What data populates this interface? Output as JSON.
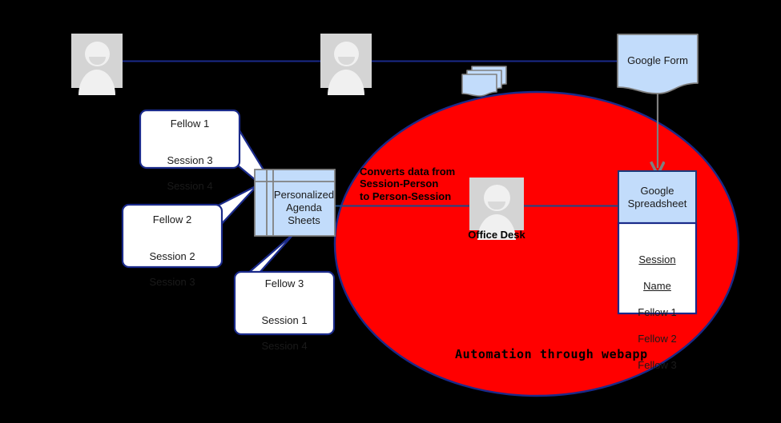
{
  "diagram": {
    "title": "Automation through webapp",
    "colors": {
      "background": "#000000",
      "process_fill": "#ff0000",
      "process_stroke": "#1a2a8a",
      "node_fill": "#c2dcfb",
      "node_stroke": "#1b3a7a",
      "callout_fill": "#ffffff",
      "callout_stroke": "#1a2a8a",
      "connector": "#1a2a8a",
      "arrow_gray": "#7f7f7f",
      "avatar_bg": "#d4d4d4"
    }
  },
  "people": [
    {
      "name": "person-1"
    },
    {
      "name": "person-2"
    }
  ],
  "nodes": {
    "google_form": {
      "label": "Google Form"
    },
    "agenda_sheets": {
      "label": "Personalized\nAgenda\nSheets"
    },
    "google_spreadsheet": {
      "label": "Google\nSpreadsheet"
    },
    "documents_stack": {
      "label": ""
    },
    "office_desk": {
      "label": "Office Desk"
    }
  },
  "process": {
    "conversion_note": "Converts data from\nSession-Person\nto Person-Session",
    "caption": "Automation through webapp"
  },
  "spreadsheet_list": {
    "header_line_1": "Session",
    "header_line_2": "Name",
    "rows": [
      "Fellow 1",
      "Fellow 2",
      "Fellow 3"
    ]
  },
  "callouts": [
    {
      "id": "fellow-1",
      "title": "Fellow 1",
      "sessions": [
        "Session 3",
        "Session 4"
      ]
    },
    {
      "id": "fellow-2",
      "title": "Fellow 2",
      "sessions": [
        "Session 2",
        "Session 3"
      ]
    },
    {
      "id": "fellow-3",
      "title": "Fellow 3",
      "sessions": [
        "Session 1",
        "Session 4"
      ]
    }
  ]
}
